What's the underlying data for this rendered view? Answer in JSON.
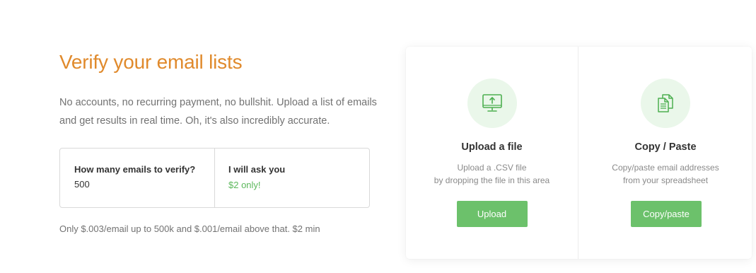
{
  "intro": {
    "headline": "Verify your email lists",
    "description": "No accounts, no recurring payment, no bullshit. Upload a list of emails and get results in real time. Oh, it's also incredibly accurate."
  },
  "calculator": {
    "count_label": "How many emails to verify?",
    "count_value": "500",
    "price_label": "I will ask you",
    "price_value": "$2 only!"
  },
  "pricing_note": "Only $.003/email up to 500k and $.001/email above that. $2 min",
  "upload": {
    "icon": "monitor-upload-icon",
    "title": "Upload a file",
    "desc_line1": "Upload a .CSV file",
    "desc_line2": "by dropping the file in this area",
    "button": "Upload"
  },
  "paste": {
    "icon": "copy-documents-icon",
    "title": "Copy / Paste",
    "desc_line1": "Copy/paste email addresses",
    "desc_line2": "from your spreadsheet",
    "button": "Copy/paste"
  },
  "colors": {
    "headline": "#e08a2c",
    "accent_green": "#6cc16b",
    "price_green": "#5cb85c",
    "icon_bg": "#eaf7ea"
  }
}
